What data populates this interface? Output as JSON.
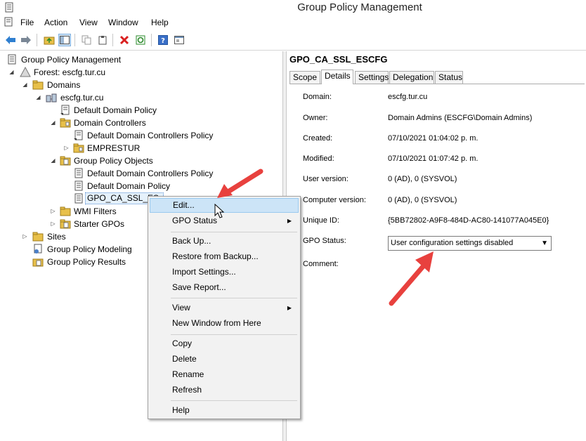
{
  "window": {
    "title": "Group Policy Management"
  },
  "menu": [
    "File",
    "Action",
    "View",
    "Window",
    "Help"
  ],
  "toolbar": {
    "icons": [
      "back-arrow-icon",
      "forward-arrow-icon",
      "up-folder-icon",
      "show-hide-tree-icon",
      "copy-icon",
      "paste-icon",
      "delete-icon",
      "refresh-icon",
      "help-icon",
      "properties-icon"
    ]
  },
  "tree": {
    "root": "Group Policy Management",
    "forest": "Forest: escfg.tur.cu",
    "domains": "Domains",
    "domain": "escfg.tur.cu",
    "ddp": "Default Domain Policy",
    "dc": "Domain Controllers",
    "ddcp": "Default Domain Controllers Policy",
    "emprestur": "EMPRESTUR",
    "gpo_objects": "Group Policy Objects",
    "gpo_ddcp": "Default Domain Controllers Policy",
    "gpo_ddp": "Default Domain Policy",
    "gpo_selected": "GPO_CA_SSL_ES",
    "wmi": "WMI Filters",
    "starter": "Starter GPOs",
    "sites": "Sites",
    "modeling": "Group Policy Modeling",
    "results": "Group Policy Results"
  },
  "context_menu": {
    "edit": "Edit...",
    "gpo_status": "GPO Status",
    "backup": "Back Up...",
    "restore": "Restore from Backup...",
    "import": "Import Settings...",
    "save_report": "Save Report...",
    "view": "View",
    "new_window": "New Window from Here",
    "copy": "Copy",
    "delete": "Delete",
    "rename": "Rename",
    "refresh": "Refresh",
    "help": "Help"
  },
  "details": {
    "title": "GPO_CA_SSL_ESCFG",
    "tabs": [
      "Scope",
      "Details",
      "Settings",
      "Delegation",
      "Status"
    ],
    "active_tab": "Details",
    "domain_label": "Domain:",
    "domain_value": "escfg.tur.cu",
    "owner_label": "Owner:",
    "owner_value": "Domain Admins (ESCFG\\Domain Admins)",
    "created_label": "Created:",
    "created_value": "07/10/2021 01:04:02 p. m.",
    "modified_label": "Modified:",
    "modified_value": "07/10/2021 01:07:42 p. m.",
    "user_version_label": "User version:",
    "user_version_value": "0 (AD), 0 (SYSVOL)",
    "computer_version_label": "Computer version:",
    "computer_version_value": "0 (AD), 0 (SYSVOL)",
    "unique_id_label": "Unique ID:",
    "unique_id_value": "{5BB72802-A9F8-484D-AC80-141077A045E0}",
    "gpo_status_label": "GPO Status:",
    "gpo_status_value": "User configuration settings disabled",
    "comment_label": "Comment:"
  },
  "colors": {
    "arrow": "#e8413e",
    "selection": "#cce4f7",
    "folder": "#e8c04a"
  }
}
